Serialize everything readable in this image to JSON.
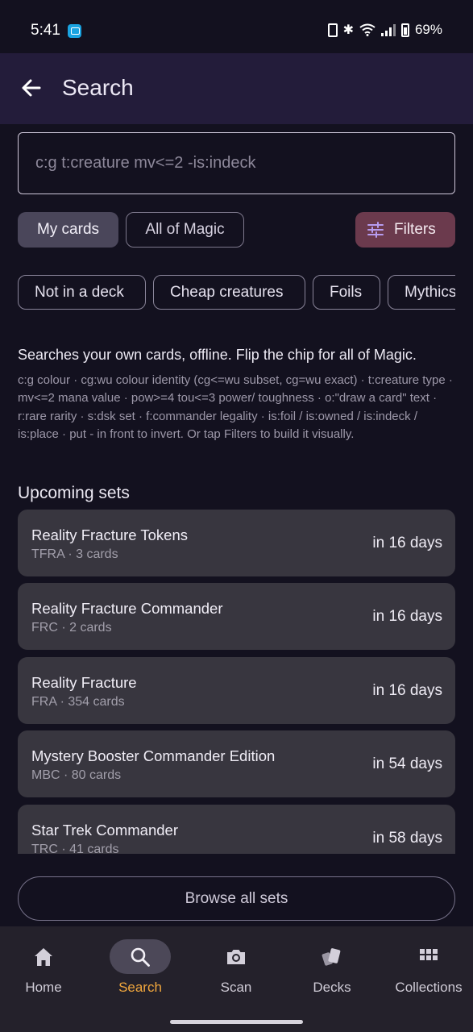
{
  "status_bar": {
    "time": "5:41",
    "battery": "69%",
    "icons": [
      "notification-icon",
      "vibrate-icon",
      "bluetooth-icon",
      "wifi-icon",
      "signal-icon",
      "battery-icon"
    ]
  },
  "app_bar": {
    "title": "Search",
    "back_icon": "arrow-left-icon"
  },
  "search": {
    "placeholder": "c:g t:creature mv<=2 -is:indeck",
    "value": ""
  },
  "scope": {
    "mine": "My cards",
    "all": "All of Magic",
    "selected": "My cards"
  },
  "filters": {
    "label": "Filters",
    "icon": "sliders-icon",
    "color": "#6b3a4d"
  },
  "chips": [
    "Not in a deck",
    "Cheap creatures",
    "Foils",
    "Mythics"
  ],
  "help": {
    "main": "Searches your own cards, offline. Flip the chip for all of Magic.",
    "syntax": "c:g colour · cg:wu colour identity (cg<=wu subset, cg=wu exact) · t:creature type · mv<=2 mana value · pow>=4 tou<=3 power/ toughness · o:\"draw a card\" text · r:rare rarity · s:dsk set · f:commander legality · is:foil / is:owned / is:indeck / is:place · put - in front to invert. Or tap Filters to build it visually."
  },
  "upcoming": {
    "title": "Upcoming sets",
    "sets": [
      {
        "name": "Reality Fracture Tokens",
        "meta": "TFRA · 3 cards",
        "when": "in 16 days"
      },
      {
        "name": "Reality Fracture Commander",
        "meta": "FRC · 2 cards",
        "when": "in 16 days"
      },
      {
        "name": "Reality Fracture",
        "meta": "FRA · 354 cards",
        "when": "in 16 days"
      },
      {
        "name": "Mystery Booster Commander Edition",
        "meta": "MBC · 80 cards",
        "when": "in 54 days"
      },
      {
        "name": "Star Trek Commander",
        "meta": "TRC · 41 cards",
        "when": "in 58 days"
      }
    ]
  },
  "browse_label": "Browse all sets",
  "nav": {
    "active": "Search",
    "active_color": "#f0a63d",
    "items": [
      {
        "label": "Home",
        "icon": "home-icon"
      },
      {
        "label": "Search",
        "icon": "search-icon"
      },
      {
        "label": "Scan",
        "icon": "camera-icon"
      },
      {
        "label": "Decks",
        "icon": "cards-icon"
      },
      {
        "label": "Collections",
        "icon": "grid-icon"
      }
    ]
  }
}
